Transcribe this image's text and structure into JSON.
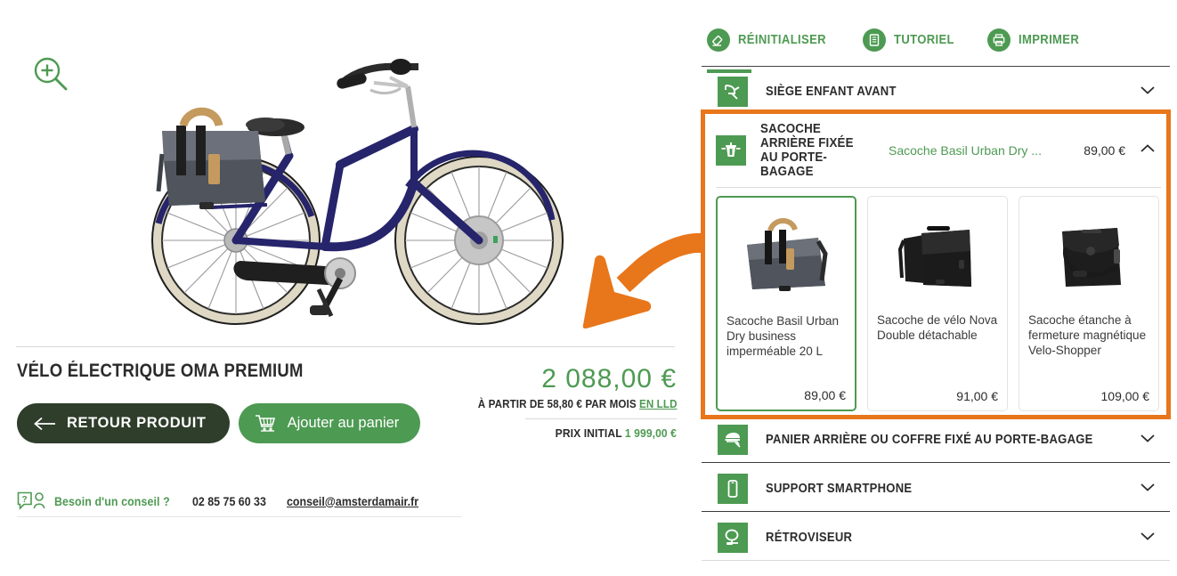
{
  "colors": {
    "green": "#4d9a52",
    "dark_green": "#2f3d2b",
    "orange": "#e8761a",
    "text": "#2b2b2b",
    "border": "#e2e2e2"
  },
  "left": {
    "zoom_icon": "magnifier-plus-icon",
    "product_image_alt": "blue electric city bike with grey pannier bag",
    "title": "VÉLO ÉLECTRIQUE OMA PREMIUM",
    "back_button": "RETOUR PRODUIT",
    "add_to_cart_button": "Ajouter au panier",
    "price": {
      "main": "2 088,00 €",
      "monthly_prefix": "À PARTIR DE 58,80 € PAR MOIS",
      "monthly_link": "EN LLD",
      "initial_label": "PRIX INITIAL",
      "initial_amount": "1 999,00 €"
    },
    "advice": {
      "label": "Besoin d'un conseil ?",
      "phone": "02 85 75 60 33",
      "email": "conseil@amsterdamair.fr"
    }
  },
  "right": {
    "tools": [
      {
        "label": "RÉINITIALISER",
        "icon": "eraser-icon"
      },
      {
        "label": "TUTORIEL",
        "icon": "document-icon"
      },
      {
        "label": "IMPRIMER",
        "icon": "printer-icon"
      }
    ],
    "sections": [
      {
        "label": "SIÈGE ENFANT AVANT",
        "icon": "child-seat-icon",
        "state": "collapsed",
        "chevron": "chevron-down"
      },
      {
        "label": "PANIER ARRIÈRE OU COFFRE FIXÉ AU PORTE-BAGAGE",
        "icon": "rear-basket-icon",
        "state": "collapsed",
        "chevron": "chevron-down"
      },
      {
        "label": "SUPPORT SMARTPHONE",
        "icon": "smartphone-icon",
        "state": "collapsed",
        "chevron": "chevron-down"
      },
      {
        "label": "RÉTROVISEUR",
        "icon": "mirror-icon",
        "state": "collapsed",
        "chevron": "chevron-down"
      }
    ],
    "open_section": {
      "label": "SACOCHE ARRIÈRE FIXÉE AU PORTE-BAGAGE",
      "icon": "pannier-bag-icon",
      "selected_name": "Sacoche Basil Urban Dry ...",
      "selected_price": "89,00 €",
      "chevron": "chevron-up",
      "highlighted": true,
      "options": [
        {
          "name": "Sacoche Basil Urban Dry business imperméable 20 L",
          "price": "89,00 €",
          "selected": true,
          "image": "grey-canvas-pannier"
        },
        {
          "name": "Sacoche de vélo Nova Double détachable",
          "price": "91,00 €",
          "selected": false,
          "image": "black-double-pannier"
        },
        {
          "name": "Sacoche étanche à fermeture magnétique Velo-Shopper",
          "price": "109,00 €",
          "selected": false,
          "image": "black-waterproof-pannier"
        }
      ]
    }
  },
  "annotation": {
    "type": "curved-arrow",
    "color": "#e8761a",
    "points_to": "open-section-highlight"
  }
}
